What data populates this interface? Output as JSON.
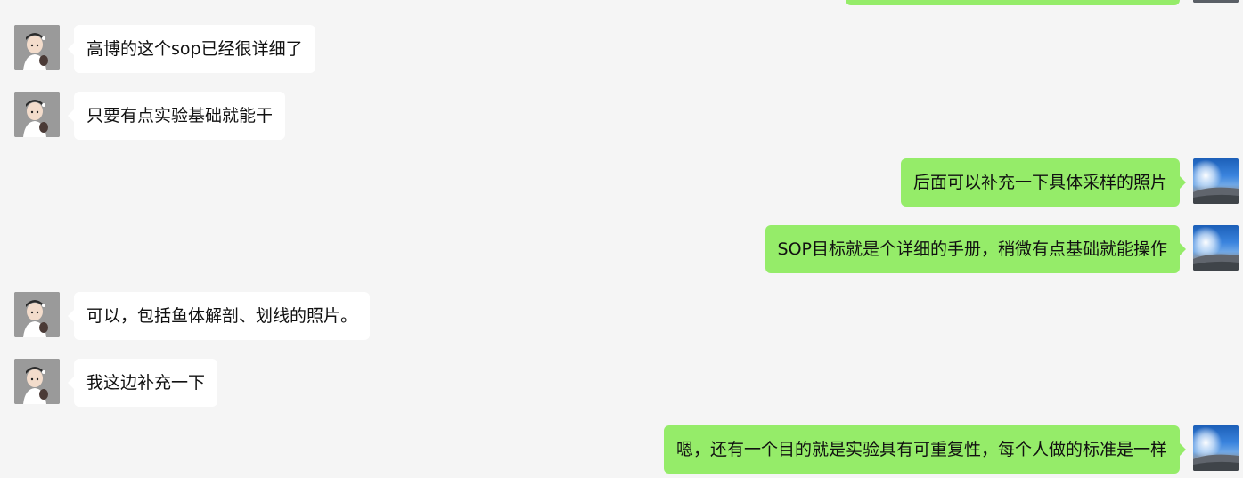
{
  "chat": {
    "colors": {
      "background": "#f5f5f5",
      "incoming_bubble": "#ffffff",
      "outgoing_bubble": "#95ec69",
      "text": "#111111"
    },
    "messages": [
      {
        "side": "right",
        "text": ""
      },
      {
        "side": "left",
        "text": "高博的这个sop已经很详细了"
      },
      {
        "side": "left",
        "text": "只要有点实验基础就能干"
      },
      {
        "side": "right",
        "text": "后面可以补充一下具体采样的照片"
      },
      {
        "side": "right",
        "text": "SOP目标就是个详细的手册，稍微有点基础就能操作"
      },
      {
        "side": "left",
        "text": "可以，包括鱼体解剖、划线的照片。"
      },
      {
        "side": "left",
        "text": "我这边补充一下"
      },
      {
        "side": "right",
        "text": "嗯，还有一个目的就是实验具有可重复性，每个人做的标准是一样"
      }
    ]
  }
}
